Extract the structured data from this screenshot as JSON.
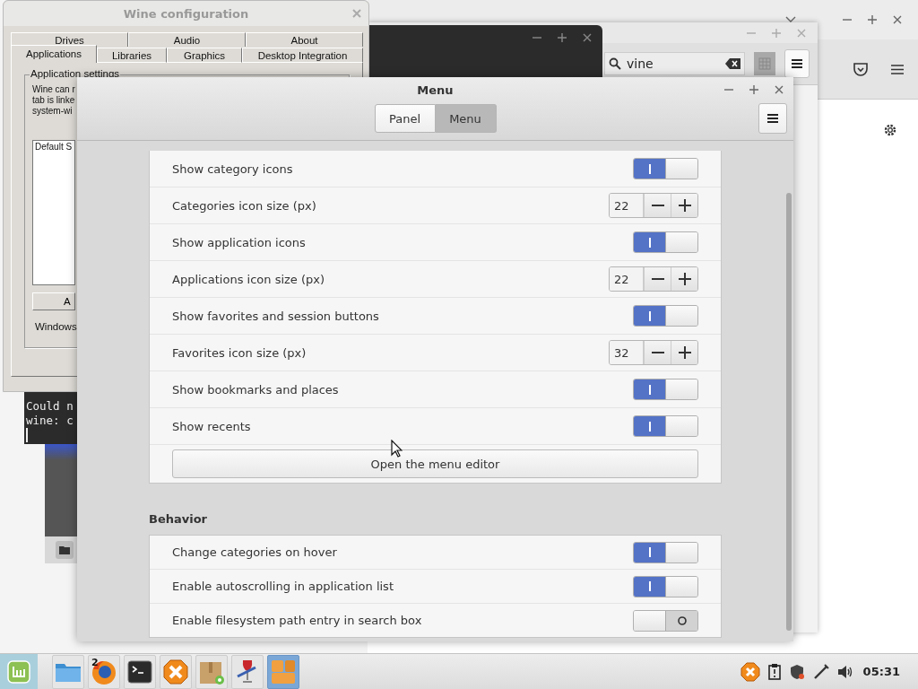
{
  "browser_window": {
    "search": {
      "value": "vine"
    }
  },
  "terminal": {
    "lines": [
      "Could n",
      "wine: c"
    ]
  },
  "wine_window": {
    "title": "Wine configuration",
    "tabs_row_1": [
      {
        "label": "Drives",
        "selected": false
      },
      {
        "label": "Audio",
        "selected": false
      },
      {
        "label": "About",
        "selected": false
      }
    ],
    "tabs_row_2": [
      {
        "label": "Applications",
        "selected": true
      },
      {
        "label": "Libraries",
        "selected": false
      },
      {
        "label": "Graphics",
        "selected": false
      },
      {
        "label": "Desktop Integration",
        "selected": false
      }
    ],
    "group_title": "Application settings",
    "description_lines": [
      "Wine can r",
      "tab is linke",
      "system-wi"
    ],
    "list_header": "Default S",
    "button": "A",
    "label": "Windows"
  },
  "menu_window": {
    "title": "Menu",
    "stack": [
      {
        "label": "Panel",
        "selected": false
      },
      {
        "label": "Menu",
        "selected": true
      }
    ],
    "sections": [
      {
        "rows": [
          {
            "kind": "toggle",
            "label": "Show category icons",
            "on": true
          },
          {
            "kind": "spin",
            "label": "Categories icon size (px)",
            "value": "22"
          },
          {
            "kind": "toggle",
            "label": "Show application icons",
            "on": true
          },
          {
            "kind": "spin",
            "label": "Applications icon size (px)",
            "value": "22"
          },
          {
            "kind": "toggle",
            "label": "Show favorites and session buttons",
            "on": true
          },
          {
            "kind": "spin",
            "label": "Favorites icon size (px)",
            "value": "32"
          },
          {
            "kind": "toggle",
            "label": "Show bookmarks and places",
            "on": true
          },
          {
            "kind": "toggle",
            "label": "Show recents",
            "on": true
          },
          {
            "kind": "button",
            "label": "Open the menu editor"
          }
        ]
      },
      {
        "heading": "Behavior",
        "rows": [
          {
            "kind": "toggle",
            "label": "Change categories on hover",
            "on": true
          },
          {
            "kind": "toggle",
            "label": "Enable autoscrolling in application list",
            "on": true
          },
          {
            "kind": "toggle",
            "label": "Enable filesystem path entry in search box",
            "on": false
          }
        ]
      }
    ]
  },
  "taskbar": {
    "apps": [
      {
        "kind": "folder",
        "selected": false
      },
      {
        "kind": "firefox",
        "badge": "2",
        "selected": false
      },
      {
        "kind": "terminal",
        "selected": false
      },
      {
        "kind": "hexagon",
        "selected": false
      },
      {
        "kind": "package",
        "selected": false
      },
      {
        "kind": "wine",
        "selected": false
      },
      {
        "kind": "blocks",
        "selected": true
      }
    ],
    "clock": "05:31"
  }
}
